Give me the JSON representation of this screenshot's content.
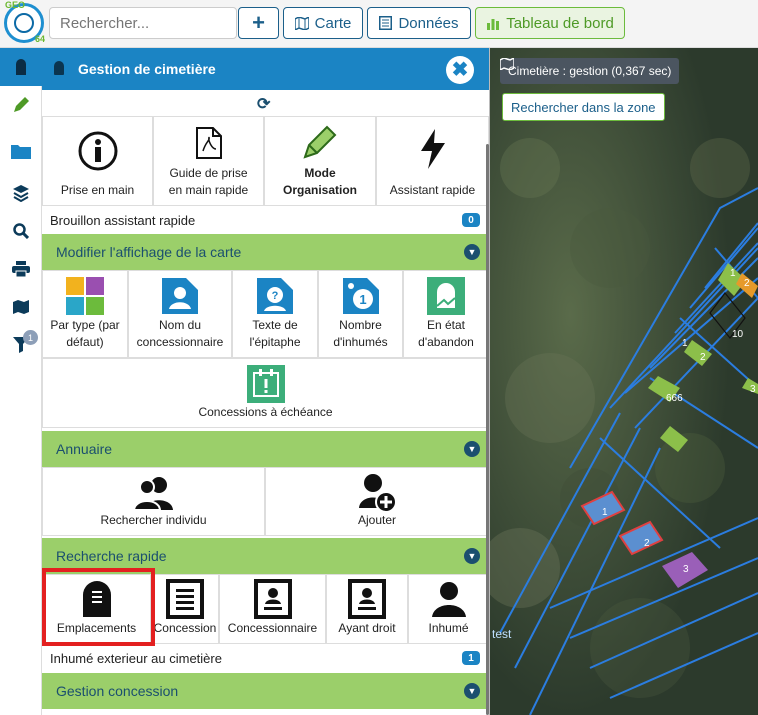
{
  "search": {
    "placeholder": "Rechercher..."
  },
  "toolbar": {
    "plus_label": "+",
    "carte_label": "Carte",
    "donnees_label": "Données",
    "tableau_label": "Tableau de bord"
  },
  "logo": {
    "top": "GEO",
    "bottom": "64"
  },
  "rail": {
    "filter_badge": "1"
  },
  "panel": {
    "title": "Gestion de cimetière",
    "close_label": "✖",
    "refresh_glyph": "⟳",
    "top_tiles": [
      {
        "label": "Prise en main"
      },
      {
        "label": "Guide de prise en main rapide"
      },
      {
        "label": "Mode Organisation"
      },
      {
        "label": "Assistant rapide"
      }
    ],
    "brouillon": {
      "label": "Brouillon assistant rapide",
      "count": "0"
    },
    "sections": {
      "affichage": "Modifier l'affichage de la carte",
      "annuaire": "Annuaire",
      "recherche": "Recherche rapide",
      "concession": "Gestion concession"
    },
    "affichage_tiles": [
      {
        "label": "Par type (par défaut)"
      },
      {
        "label": "Nom du concessionnaire"
      },
      {
        "label": "Texte de l'épitaphe"
      },
      {
        "label": "Nombre d'inhumés"
      },
      {
        "label": "En état d'abandon"
      },
      {
        "label": "Concessions à échéance"
      }
    ],
    "annuaire_tiles": [
      {
        "label": "Rechercher individu"
      },
      {
        "label": "Ajouter"
      }
    ],
    "recherche_tiles": [
      {
        "label": "Emplacements"
      },
      {
        "label": "Concession"
      },
      {
        "label": "Concessionnaire"
      },
      {
        "label": "Ayant droit"
      },
      {
        "label": "Inhumé"
      }
    ],
    "inhume_ext": {
      "label": "Inhumé exterieur au cimetière",
      "count": "1"
    }
  },
  "map": {
    "tag": "Cimetière : gestion (0,367 sec)",
    "search_zone": "Rechercher dans la zone",
    "labels": [
      "1",
      "2",
      "10",
      "1",
      "2",
      "3",
      "666",
      "1",
      "2",
      "3",
      "test"
    ]
  },
  "colors": {
    "accent": "#1b84c4",
    "section": "#9bcf6a",
    "highlight": "#e32020"
  }
}
